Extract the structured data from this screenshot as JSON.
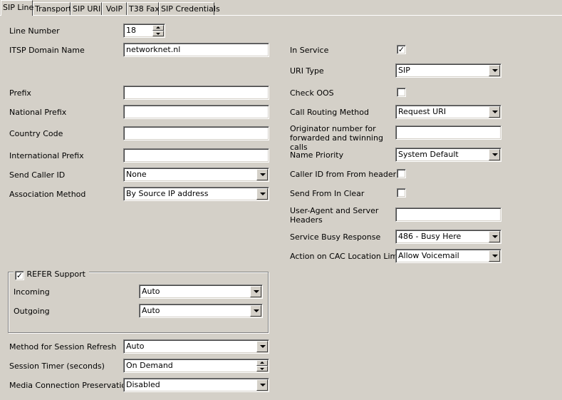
{
  "tabs": [
    {
      "label": "SIP Line",
      "active": true
    },
    {
      "label": "Transport",
      "active": false
    },
    {
      "label": "SIP URI",
      "active": false
    },
    {
      "label": "VoIP",
      "active": false
    },
    {
      "label": "T38 Fax",
      "active": false
    },
    {
      "label": "SIP Credentials",
      "active": false
    }
  ],
  "left": {
    "line_number": {
      "label": "Line Number",
      "value": "18"
    },
    "itsp_domain": {
      "label": "ITSP Domain Name",
      "value": "networknet.nl"
    },
    "prefix": {
      "label": "Prefix",
      "value": ""
    },
    "national_prefix": {
      "label": "National Prefix",
      "value": ""
    },
    "country_code": {
      "label": "Country Code",
      "value": ""
    },
    "international_prefix": {
      "label": "International Prefix",
      "value": ""
    },
    "send_caller_id": {
      "label": "Send Caller ID",
      "value": "None"
    },
    "association_method": {
      "label": "Association Method",
      "value": "By Source IP address"
    },
    "refer": {
      "label": "REFER Support",
      "checked": true,
      "incoming": {
        "label": "Incoming",
        "value": "Auto"
      },
      "outgoing": {
        "label": "Outgoing",
        "value": "Auto"
      }
    },
    "session_refresh": {
      "label": "Method for Session Refresh",
      "value": "Auto"
    },
    "session_timer": {
      "label": "Session Timer (seconds)",
      "value": "On Demand"
    },
    "media_preservation": {
      "label": "Media Connection Preservation",
      "value": "Disabled"
    }
  },
  "right": {
    "in_service": {
      "label": "In Service",
      "checked": true
    },
    "uri_type": {
      "label": "URI Type",
      "value": "SIP"
    },
    "check_oos": {
      "label": "Check OOS",
      "checked": false
    },
    "call_routing": {
      "label": "Call Routing Method",
      "value": "Request URI"
    },
    "originator": {
      "label": "Originator number for forwarded and twinning calls",
      "value": ""
    },
    "name_priority": {
      "label": "Name Priority",
      "value": "System Default"
    },
    "caller_id_from": {
      "label": "Caller ID from From header",
      "checked": false
    },
    "send_from_clear": {
      "label": "Send From In Clear",
      "checked": false
    },
    "user_agent": {
      "label": "User-Agent and Server Headers",
      "value": ""
    },
    "service_busy": {
      "label": "Service Busy Response",
      "value": "486 - Busy Here"
    },
    "cac_action": {
      "label": "Action on CAC Location Limit",
      "value": "Allow Voicemail"
    }
  },
  "icons": {
    "checkmark": "✓",
    "dropdown": "chevron-down-icon",
    "spinner": "spin-arrows-icon"
  }
}
